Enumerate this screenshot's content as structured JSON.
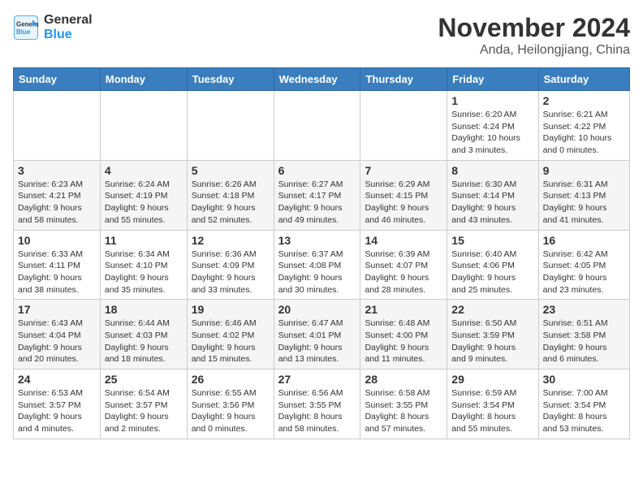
{
  "header": {
    "logo_line1": "General",
    "logo_line2": "Blue",
    "month_year": "November 2024",
    "location": "Anda, Heilongjiang, China"
  },
  "weekdays": [
    "Sunday",
    "Monday",
    "Tuesday",
    "Wednesday",
    "Thursday",
    "Friday",
    "Saturday"
  ],
  "weeks": [
    [
      {
        "day": "",
        "info": ""
      },
      {
        "day": "",
        "info": ""
      },
      {
        "day": "",
        "info": ""
      },
      {
        "day": "",
        "info": ""
      },
      {
        "day": "",
        "info": ""
      },
      {
        "day": "1",
        "info": "Sunrise: 6:20 AM\nSunset: 4:24 PM\nDaylight: 10 hours\nand 3 minutes."
      },
      {
        "day": "2",
        "info": "Sunrise: 6:21 AM\nSunset: 4:22 PM\nDaylight: 10 hours\nand 0 minutes."
      }
    ],
    [
      {
        "day": "3",
        "info": "Sunrise: 6:23 AM\nSunset: 4:21 PM\nDaylight: 9 hours\nand 58 minutes."
      },
      {
        "day": "4",
        "info": "Sunrise: 6:24 AM\nSunset: 4:19 PM\nDaylight: 9 hours\nand 55 minutes."
      },
      {
        "day": "5",
        "info": "Sunrise: 6:26 AM\nSunset: 4:18 PM\nDaylight: 9 hours\nand 52 minutes."
      },
      {
        "day": "6",
        "info": "Sunrise: 6:27 AM\nSunset: 4:17 PM\nDaylight: 9 hours\nand 49 minutes."
      },
      {
        "day": "7",
        "info": "Sunrise: 6:29 AM\nSunset: 4:15 PM\nDaylight: 9 hours\nand 46 minutes."
      },
      {
        "day": "8",
        "info": "Sunrise: 6:30 AM\nSunset: 4:14 PM\nDaylight: 9 hours\nand 43 minutes."
      },
      {
        "day": "9",
        "info": "Sunrise: 6:31 AM\nSunset: 4:13 PM\nDaylight: 9 hours\nand 41 minutes."
      }
    ],
    [
      {
        "day": "10",
        "info": "Sunrise: 6:33 AM\nSunset: 4:11 PM\nDaylight: 9 hours\nand 38 minutes."
      },
      {
        "day": "11",
        "info": "Sunrise: 6:34 AM\nSunset: 4:10 PM\nDaylight: 9 hours\nand 35 minutes."
      },
      {
        "day": "12",
        "info": "Sunrise: 6:36 AM\nSunset: 4:09 PM\nDaylight: 9 hours\nand 33 minutes."
      },
      {
        "day": "13",
        "info": "Sunrise: 6:37 AM\nSunset: 4:08 PM\nDaylight: 9 hours\nand 30 minutes."
      },
      {
        "day": "14",
        "info": "Sunrise: 6:39 AM\nSunset: 4:07 PM\nDaylight: 9 hours\nand 28 minutes."
      },
      {
        "day": "15",
        "info": "Sunrise: 6:40 AM\nSunset: 4:06 PM\nDaylight: 9 hours\nand 25 minutes."
      },
      {
        "day": "16",
        "info": "Sunrise: 6:42 AM\nSunset: 4:05 PM\nDaylight: 9 hours\nand 23 minutes."
      }
    ],
    [
      {
        "day": "17",
        "info": "Sunrise: 6:43 AM\nSunset: 4:04 PM\nDaylight: 9 hours\nand 20 minutes."
      },
      {
        "day": "18",
        "info": "Sunrise: 6:44 AM\nSunset: 4:03 PM\nDaylight: 9 hours\nand 18 minutes."
      },
      {
        "day": "19",
        "info": "Sunrise: 6:46 AM\nSunset: 4:02 PM\nDaylight: 9 hours\nand 15 minutes."
      },
      {
        "day": "20",
        "info": "Sunrise: 6:47 AM\nSunset: 4:01 PM\nDaylight: 9 hours\nand 13 minutes."
      },
      {
        "day": "21",
        "info": "Sunrise: 6:48 AM\nSunset: 4:00 PM\nDaylight: 9 hours\nand 11 minutes."
      },
      {
        "day": "22",
        "info": "Sunrise: 6:50 AM\nSunset: 3:59 PM\nDaylight: 9 hours\nand 9 minutes."
      },
      {
        "day": "23",
        "info": "Sunrise: 6:51 AM\nSunset: 3:58 PM\nDaylight: 9 hours\nand 6 minutes."
      }
    ],
    [
      {
        "day": "24",
        "info": "Sunrise: 6:53 AM\nSunset: 3:57 PM\nDaylight: 9 hours\nand 4 minutes."
      },
      {
        "day": "25",
        "info": "Sunrise: 6:54 AM\nSunset: 3:57 PM\nDaylight: 9 hours\nand 2 minutes."
      },
      {
        "day": "26",
        "info": "Sunrise: 6:55 AM\nSunset: 3:56 PM\nDaylight: 9 hours\nand 0 minutes."
      },
      {
        "day": "27",
        "info": "Sunrise: 6:56 AM\nSunset: 3:55 PM\nDaylight: 8 hours\nand 58 minutes."
      },
      {
        "day": "28",
        "info": "Sunrise: 6:58 AM\nSunset: 3:55 PM\nDaylight: 8 hours\nand 57 minutes."
      },
      {
        "day": "29",
        "info": "Sunrise: 6:59 AM\nSunset: 3:54 PM\nDaylight: 8 hours\nand 55 minutes."
      },
      {
        "day": "30",
        "info": "Sunrise: 7:00 AM\nSunset: 3:54 PM\nDaylight: 8 hours\nand 53 minutes."
      }
    ]
  ]
}
